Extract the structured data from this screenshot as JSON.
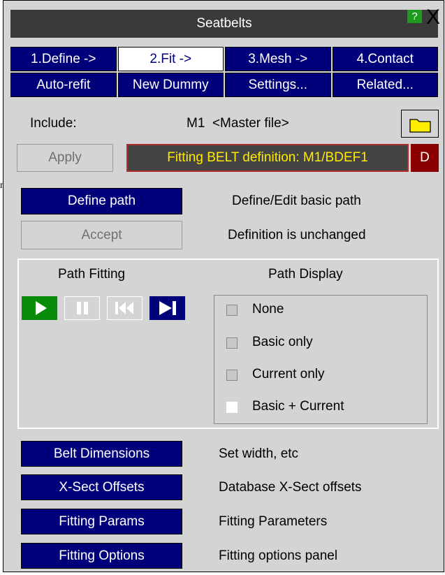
{
  "edge": {
    "fragment": "n"
  },
  "window": {
    "title": "Seatbelts",
    "help_label": "?",
    "close_label": "X"
  },
  "tabs": [
    {
      "label": "1.Define ->"
    },
    {
      "label": "2.Fit ->",
      "active": true
    },
    {
      "label": "3.Mesh ->"
    },
    {
      "label": "4.Contact"
    }
  ],
  "toolbar": [
    {
      "label": "Auto-refit"
    },
    {
      "label": "New Dummy"
    },
    {
      "label": "Settings..."
    },
    {
      "label": "Related..."
    }
  ],
  "include": {
    "label": "Include:",
    "value": "M1  <Master file>"
  },
  "apply": {
    "label": "Apply"
  },
  "fitting_banner": {
    "text": "Fitting BELT definition: M1/BDEF1",
    "badge": "D"
  },
  "define_path": {
    "button": "Define path",
    "desc": "Define/Edit basic path"
  },
  "accept": {
    "button": "Accept",
    "desc": "Definition is unchanged"
  },
  "path_fitting": {
    "title": "Path Fitting",
    "controls": [
      "play-icon",
      "pause-icon",
      "skip-back-icon",
      "skip-end-icon"
    ]
  },
  "path_display": {
    "title": "Path Display",
    "options": [
      "None",
      "Basic only",
      "Current only",
      "Basic + Current"
    ],
    "selected": "Basic + Current"
  },
  "actions": [
    {
      "button": "Belt Dimensions",
      "desc": "Set width, etc"
    },
    {
      "button": "X-Sect Offsets",
      "desc": "Database X-Sect offsets"
    },
    {
      "button": "Fitting Params",
      "desc": "Fitting Parameters"
    },
    {
      "button": "Fitting Options",
      "desc": "Fitting options panel"
    }
  ],
  "colors": {
    "button_blue": "#00007a",
    "window_grey": "#d4d4d4",
    "play_green": "#0a8a0a",
    "banner_text": "#ffea00"
  }
}
